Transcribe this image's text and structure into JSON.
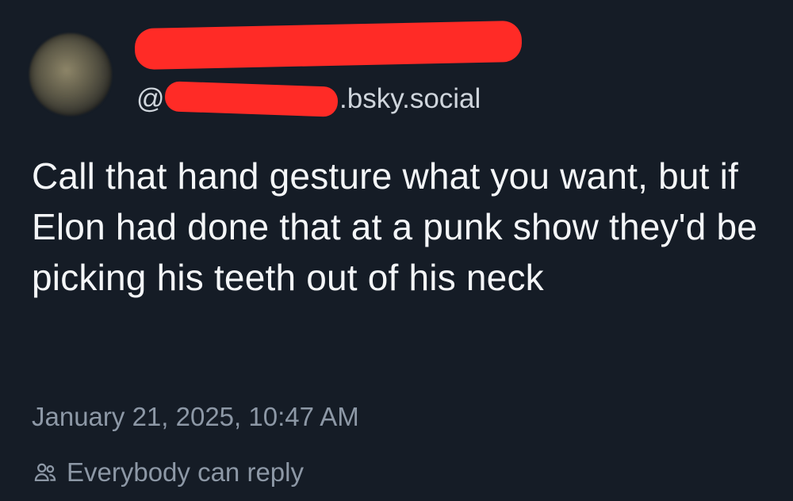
{
  "post": {
    "handle_prefix": "@",
    "handle_suffix": ".bsky.social",
    "text": "Call that hand gesture what you want, but if Elon had done that at a punk show they'd be picking his teeth out of his neck",
    "timestamp": "January 21, 2025, 10:47 AM",
    "reply_setting": "Everybody can reply"
  },
  "icons": {
    "reply_setting_icon": "people-icon"
  },
  "colors": {
    "background": "#151c26",
    "text": "#f4f6f8",
    "muted": "#8d98a6",
    "redaction": "#ff2b26"
  }
}
